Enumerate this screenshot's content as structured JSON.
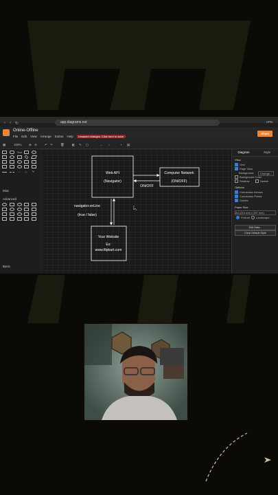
{
  "browser": {
    "url": "app.diagrams.net",
    "vpn_label": "VPN"
  },
  "app": {
    "title": "Online-Offline",
    "menu": [
      "File",
      "Edit",
      "View",
      "Arrange",
      "Extras",
      "Help"
    ],
    "unsaved_notice": "Unsaved changes. Click here to save.",
    "share_label": "Share",
    "zoom": "100%"
  },
  "left_panel": {
    "sections": [
      "Misc",
      "Advanced",
      "Basic"
    ]
  },
  "diagram": {
    "web_api": {
      "line1": "Web API",
      "line2": "(Navigator)"
    },
    "network": {
      "line1": "Computer Network",
      "line2": "(ON/OFF)"
    },
    "onoff_label": "ON/OFF",
    "online_label": "navigator.onLine",
    "bool_label": "(true / false)",
    "website": {
      "line1": "Your Website",
      "line2": "Ex:",
      "line3": "www.flipkart.com"
    }
  },
  "right_panel": {
    "tabs": [
      "Diagram",
      "Style"
    ],
    "view_heading": "View",
    "grid_label": "Grid",
    "page_view_label": "Page View",
    "background_label": "Background",
    "change_label": "Change...",
    "bg_color_label": "Background Color",
    "shadow_label": "Shadow",
    "sketch_label": "Sketch",
    "options_heading": "Options",
    "conn_arrows_label": "Connection Arrows",
    "conn_points_label": "Connection Points",
    "guides_label": "Guides",
    "paper_heading": "Paper Size",
    "paper_value": "A4 (210 mm x 297 mm)",
    "portrait_label": "Portrait",
    "landscape_label": "Landscape",
    "edit_data_label": "Edit Data...",
    "clear_style_label": "Clear Default Style"
  },
  "colors": {
    "accent": "#e8863a",
    "bg": "#0b0a06",
    "logo": "#1d1c10"
  }
}
